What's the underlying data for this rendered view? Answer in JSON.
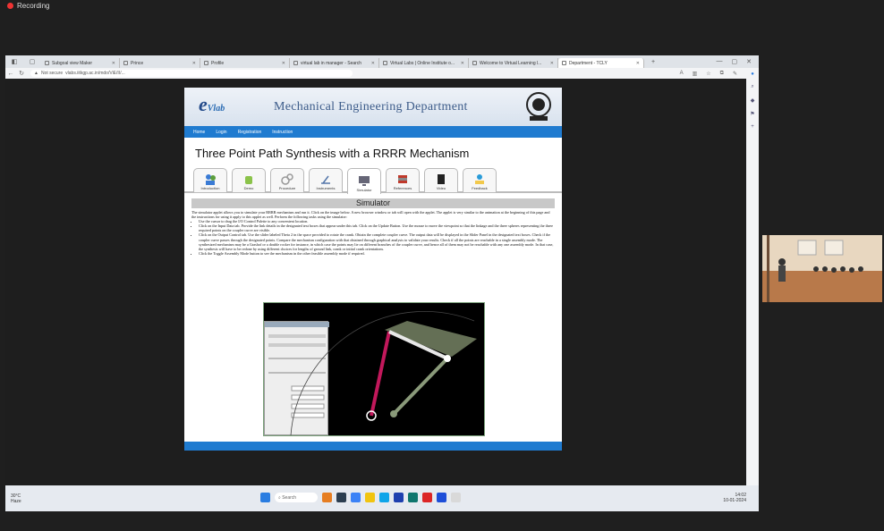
{
  "recording": {
    "label": "Recording"
  },
  "browser": {
    "tabs": [
      {
        "label": "Subgoal view Maker",
        "active": false
      },
      {
        "label": "Prince",
        "active": false
      },
      {
        "label": "Profile",
        "active": false
      },
      {
        "label": "virtual lab in manager - Search",
        "active": false
      },
      {
        "label": "Virtual Labs | Online Institute o...",
        "active": false
      },
      {
        "label": "Welcome to Virtual Learning l...",
        "active": false
      },
      {
        "label": "Department - TCLY",
        "active": true
      }
    ],
    "security_label": "Not secure",
    "url": "vlabs.iitkgp.ac.in/mdo/ViE/II/..."
  },
  "site": {
    "logo_text": "e",
    "logo_sub": "Vlab",
    "department": "Mechanical Engineering Department",
    "nav": [
      "Home",
      "Login",
      "Registration",
      "Instruction"
    ],
    "title": "Three Point Path Synthesis with a RRRR Mechanism",
    "tabs": [
      {
        "label": "Introduction",
        "icon": "people-icon"
      },
      {
        "label": "Demo",
        "icon": "android-icon"
      },
      {
        "label": "Procedure",
        "icon": "gears-icon"
      },
      {
        "label": "Instruments",
        "icon": "instrument-icon"
      },
      {
        "label": "Simulator",
        "icon": "monitor-icon"
      },
      {
        "label": "References",
        "icon": "books-icon"
      },
      {
        "label": "Video",
        "icon": "video-icon"
      },
      {
        "label": "Feedback",
        "icon": "feedback-icon"
      }
    ],
    "section_heading": "Simulator",
    "intro": "The simulator applet allows you to simulate your RRRR mechanism and run it. Click on the image below. A new browser window or tab will open with the applet. The applet is very similar to the animation at the beginning of this page and the instructions for using it apply to this applet as well. Perform the following tasks using the simulator:",
    "bullets": [
      "Use the cursor to drag the I/O Control Palette to any convenient location.",
      "Click on the Input Data tab. Provide the link details in the designated text boxes that appear under this tab. Click on the Update Button. Use the mouse to move the viewpoint so that the linkage and the three spheres representing the three required points on the coupler curve are visible.",
      "Click on the Output Control tab. Use the slider labeled Theta 2 in the space provided to rotate the crank. Obtain the complete coupler curve. The output data will be displayed in the Slider Panel in the designated text boxes. Check if the coupler curve passes through the designated points. Compare the mechanism configuration with that obtained through graphical analysis to validate your results. Check if all the points are reachable in a single assembly mode. The synthesized mechanism may be a Grashof or a double rocker for instance, in which case the points may lie on different branches of the coupler curve, and hence all of them may not be reachable with any one assembly mode. In that case, the synthesis will have to be redone by using different choices for lengths of ground link, crank or initial crank orientations.",
      "Click the Toggle Assembly Mode button to see the mechanism in the other feasible assembly mode if required."
    ]
  },
  "taskbar": {
    "weather_temp": "30°C",
    "weather_desc": "Haze",
    "search_placeholder": "Search",
    "time": "14:02",
    "date": "10-01-2024"
  },
  "colors": {
    "nav_blue": "#1f7bd0",
    "header_grey": "#c8c8c8",
    "link_magenta": "#c2185b"
  }
}
